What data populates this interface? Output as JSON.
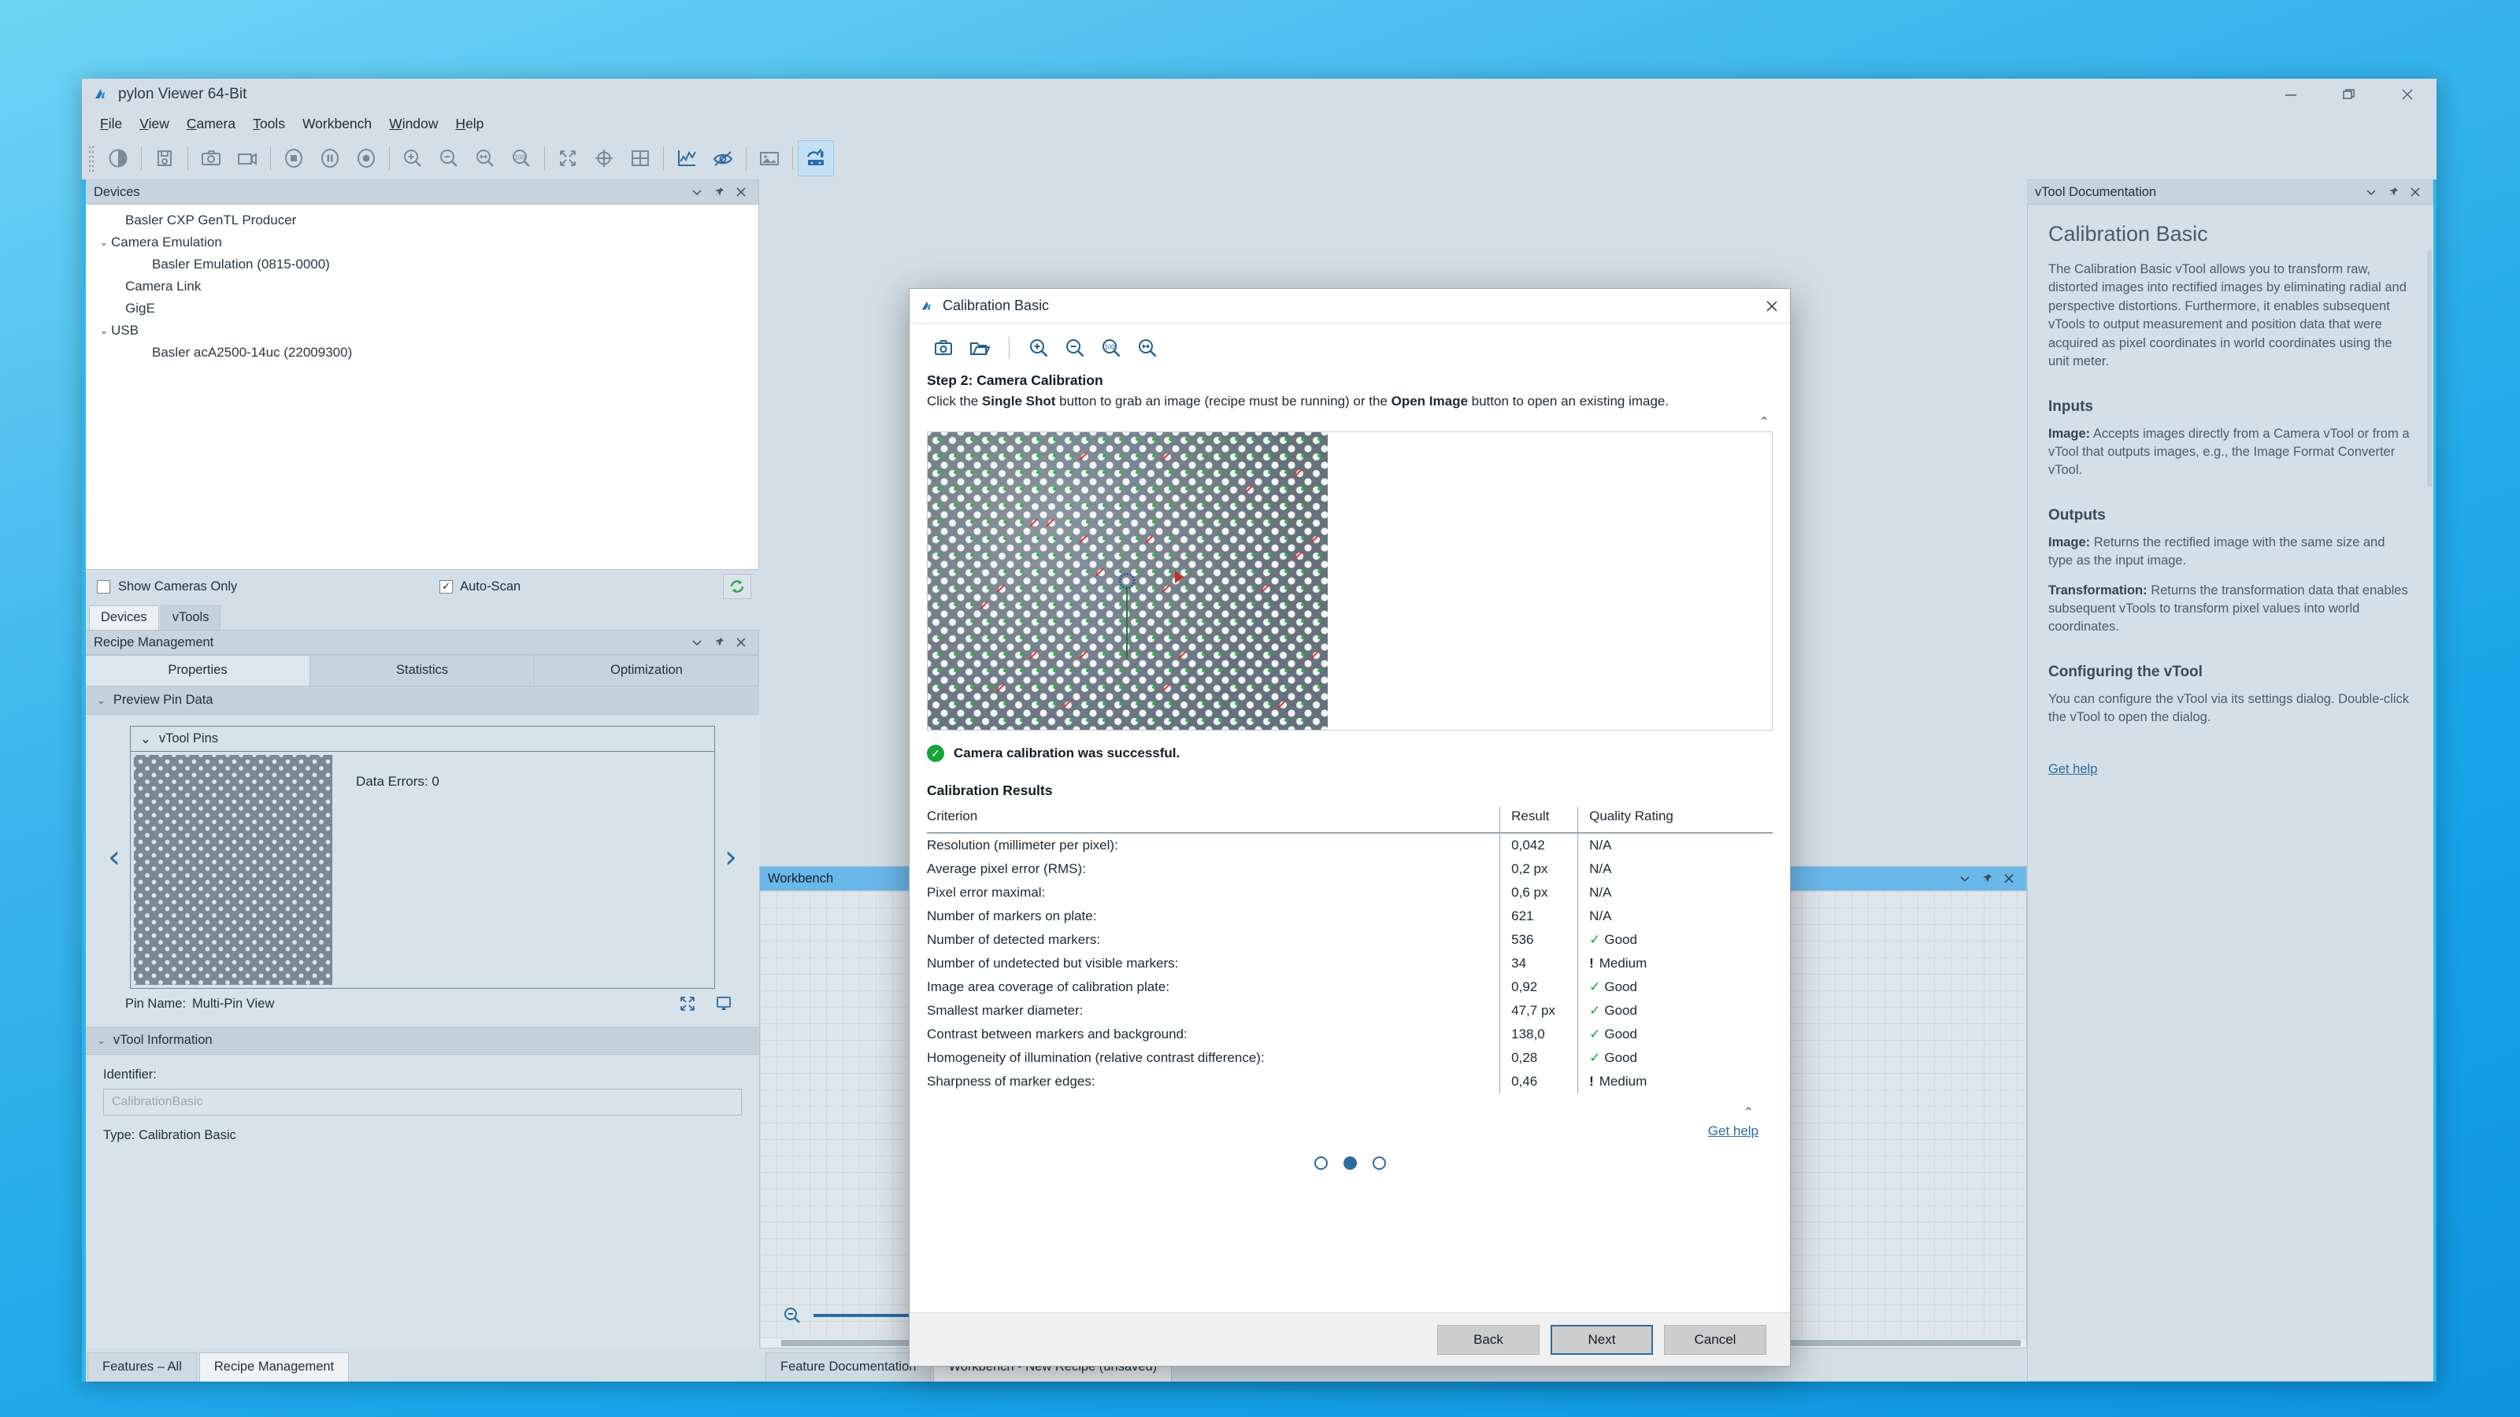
{
  "window": {
    "title": "pylon Viewer 64-Bit",
    "icon": "pylon-logo-icon",
    "controls": {
      "minimize": "—",
      "restore": "❐",
      "close": "✕"
    }
  },
  "menubar": {
    "items": [
      {
        "label": "File",
        "accel": "F"
      },
      {
        "label": "View",
        "accel": "V"
      },
      {
        "label": "Camera",
        "accel": "C"
      },
      {
        "label": "Tools",
        "accel": "T"
      },
      {
        "label": "Workbench",
        "accel": ""
      },
      {
        "label": "Window",
        "accel": "W"
      },
      {
        "label": "Help",
        "accel": "H"
      }
    ]
  },
  "toolbar": {
    "buttons": [
      "contrast-icon",
      "save-image-icon",
      "single-shot-camera-icon",
      "continuous-shot-video-icon",
      "stop-icon",
      "pause-icon",
      "record-icon",
      "zoom-in-icon",
      "zoom-out-icon",
      "zoom-fit-icon",
      "zoom-100-icon",
      "fit-to-window-icon",
      "crosshair-icon",
      "grid-icon",
      "histogram-icon",
      "pixel-peek-icon",
      "image-icon",
      "workbench-icon"
    ],
    "active_button": "workbench-icon"
  },
  "devices_panel": {
    "title": "Devices",
    "title_icons": [
      "chevron-down-icon",
      "pin-icon",
      "close-icon"
    ],
    "tree": [
      {
        "label": "Basler CXP GenTL Producer",
        "indent": 1,
        "caret": ""
      },
      {
        "label": "Camera Emulation",
        "indent": 0,
        "caret": "⌄"
      },
      {
        "label": "Basler Emulation (0815-0000)",
        "indent": 2,
        "caret": ""
      },
      {
        "label": "Camera Link",
        "indent": 1,
        "caret": ""
      },
      {
        "label": "GigE",
        "indent": 1,
        "caret": ""
      },
      {
        "label": "USB",
        "indent": 0,
        "caret": "⌄"
      },
      {
        "label": "Basler acA2500-14uc (22009300)",
        "indent": 2,
        "caret": ""
      }
    ],
    "show_cameras_only": {
      "label": "Show Cameras Only",
      "checked": false,
      "mark": ""
    },
    "auto_scan": {
      "label": "Auto-Scan",
      "checked": true,
      "mark": "✓"
    },
    "refresh_icon": "refresh-icon",
    "tabs": [
      {
        "label": "Devices",
        "selected": true
      },
      {
        "label": "vTools",
        "selected": false
      }
    ]
  },
  "recipe_panel": {
    "title": "Recipe Management",
    "title_icons": [
      "chevron-down-icon",
      "pin-icon",
      "close-icon"
    ],
    "tabs": [
      {
        "label": "Properties",
        "selected": true
      },
      {
        "label": "Statistics",
        "selected": false
      },
      {
        "label": "Optimization",
        "selected": false
      }
    ],
    "preview_group": {
      "label": "Preview Pin Data",
      "caret": "⌄"
    },
    "pins_box": {
      "header": "vTool Pins",
      "caret": "⌄",
      "data_errors": "Data Errors: 0",
      "prev_arrow": "‹",
      "next_arrow": "›"
    },
    "pin_name": {
      "label": "Pin Name:",
      "value": "Multi-Pin View"
    },
    "pin_icons": [
      "expand-icon",
      "display-icon"
    ],
    "info_group": {
      "label": "vTool Information",
      "caret": "⌄"
    },
    "identifier": {
      "label": "Identifier:",
      "placeholder": "CalibrationBasic",
      "value": ""
    },
    "type": "Type: Calibration Basic",
    "bottom_tabs": [
      {
        "label": "Features – All",
        "selected": false
      },
      {
        "label": "Recipe Management",
        "selected": true
      }
    ]
  },
  "workbench_panel": {
    "title": "Workbench",
    "title_icons": [
      "chevron-down-icon",
      "pin-icon",
      "close-icon"
    ],
    "node_port": "+",
    "zoom_out_icon": "zoom-out-icon",
    "zoom_in_icon": "zoom-in-icon",
    "zoom_slider_percent": 76,
    "bottom_tabs": [
      {
        "label": "Feature Documentation",
        "selected": false
      },
      {
        "label": "Workbench - New Recipe (unsaved)",
        "selected": true
      }
    ]
  },
  "documentation_panel": {
    "title": "vTool Documentation",
    "title_icons": [
      "chevron-down-icon",
      "pin-icon",
      "close-icon"
    ],
    "heading": "Calibration Basic",
    "intro": "The Calibration Basic vTool allows you to transform raw, distorted images into rectified images by eliminating radial and perspective distortions. Furthermore, it enables subsequent vTools to output measurement and position data that were acquired as pixel coordinates in world coordinates using the unit meter.",
    "sections": [
      {
        "heading": "Inputs",
        "paragraphs": [
          {
            "term": "Image:",
            "text": " Accepts images directly from a Camera vTool or from a vTool that outputs images, e.g., the Image Format Converter vTool."
          }
        ]
      },
      {
        "heading": "Outputs",
        "paragraphs": [
          {
            "term": "Image:",
            "text": " Returns the rectified image with the same size and type as the input image."
          },
          {
            "term": "Transformation:",
            "text": " Returns the transformation data that enables subsequent vTools to transform pixel values into world coordinates."
          }
        ]
      },
      {
        "heading": "Configuring the vTool",
        "paragraphs": [
          {
            "term": "",
            "text": "You can configure the vTool via its settings dialog. Double-click the vTool to open the dialog."
          }
        ]
      }
    ],
    "get_help": "Get help"
  },
  "dialog": {
    "title": "Calibration Basic",
    "icon": "pylon-logo-icon",
    "close": "✕",
    "toolbar": [
      "single-shot-camera-icon",
      "open-image-folder-icon",
      "zoom-in-icon",
      "zoom-out-icon",
      "zoom-100-icon",
      "zoom-fit-icon"
    ],
    "step_title": "Step 2: Camera Calibration",
    "step_desc_parts": [
      {
        "text": "Click the ",
        "bold": false
      },
      {
        "text": "Single Shot",
        "bold": true
      },
      {
        "text": " button to grab an image (recipe must be running) or the ",
        "bold": false
      },
      {
        "text": "Open Image",
        "bold": true
      },
      {
        "text": " button to open an existing image.",
        "bold": false
      }
    ],
    "collapse_caret": "⌃",
    "status": {
      "icon": "success-check-icon",
      "text": "Camera calibration was successful."
    },
    "results_title": "Calibration Results",
    "caret_up": "⌃",
    "get_help": "Get help",
    "pager": {
      "total": 3,
      "current": 2
    },
    "buttons": {
      "back": "Back",
      "next": "Next",
      "cancel": "Cancel"
    }
  },
  "chart_data": {
    "type": "table",
    "title": "Calibration Results",
    "columns": [
      "Criterion",
      "Result",
      "Quality Rating"
    ],
    "rows": [
      {
        "criterion": "Resolution (millimeter per pixel):",
        "result": "0,042",
        "quality": "N/A",
        "quality_kind": "na"
      },
      {
        "criterion": "Average pixel error (RMS):",
        "result": "0,2 px",
        "quality": "N/A",
        "quality_kind": "na"
      },
      {
        "criterion": "Pixel error maximal:",
        "result": "0,6 px",
        "quality": "N/A",
        "quality_kind": "na"
      },
      {
        "criterion": "Number of markers on plate:",
        "result": "621",
        "quality": "N/A",
        "quality_kind": "na"
      },
      {
        "criterion": "Number of detected markers:",
        "result": "536",
        "quality": "Good",
        "quality_kind": "good"
      },
      {
        "criterion": "Number of undetected but visible markers:",
        "result": "34",
        "quality": "Medium",
        "quality_kind": "medium"
      },
      {
        "criterion": "Image area coverage of calibration plate:",
        "result": "0,92",
        "quality": "Good",
        "quality_kind": "good"
      },
      {
        "criterion": "Smallest marker diameter:",
        "result": "47,7 px",
        "quality": "Good",
        "quality_kind": "good"
      },
      {
        "criterion": "Contrast between markers and background:",
        "result": "138,0",
        "quality": "Good",
        "quality_kind": "good"
      },
      {
        "criterion": "Homogeneity of illumination (relative contrast difference):",
        "result": "0,28",
        "quality": "Good",
        "quality_kind": "good"
      },
      {
        "criterion": "Sharpness of marker edges:",
        "result": "0,46",
        "quality": "Medium",
        "quality_kind": "medium"
      }
    ],
    "marks": {
      "good": "✓",
      "medium": "!"
    }
  },
  "colors": {
    "accent_blue": "#2cb6ef",
    "panel_bg": "#d4dee6",
    "active_title": "#6ab8ea",
    "link": "#2c6c9e",
    "success_green": "#17a338",
    "warn_dark": "#141d25"
  }
}
